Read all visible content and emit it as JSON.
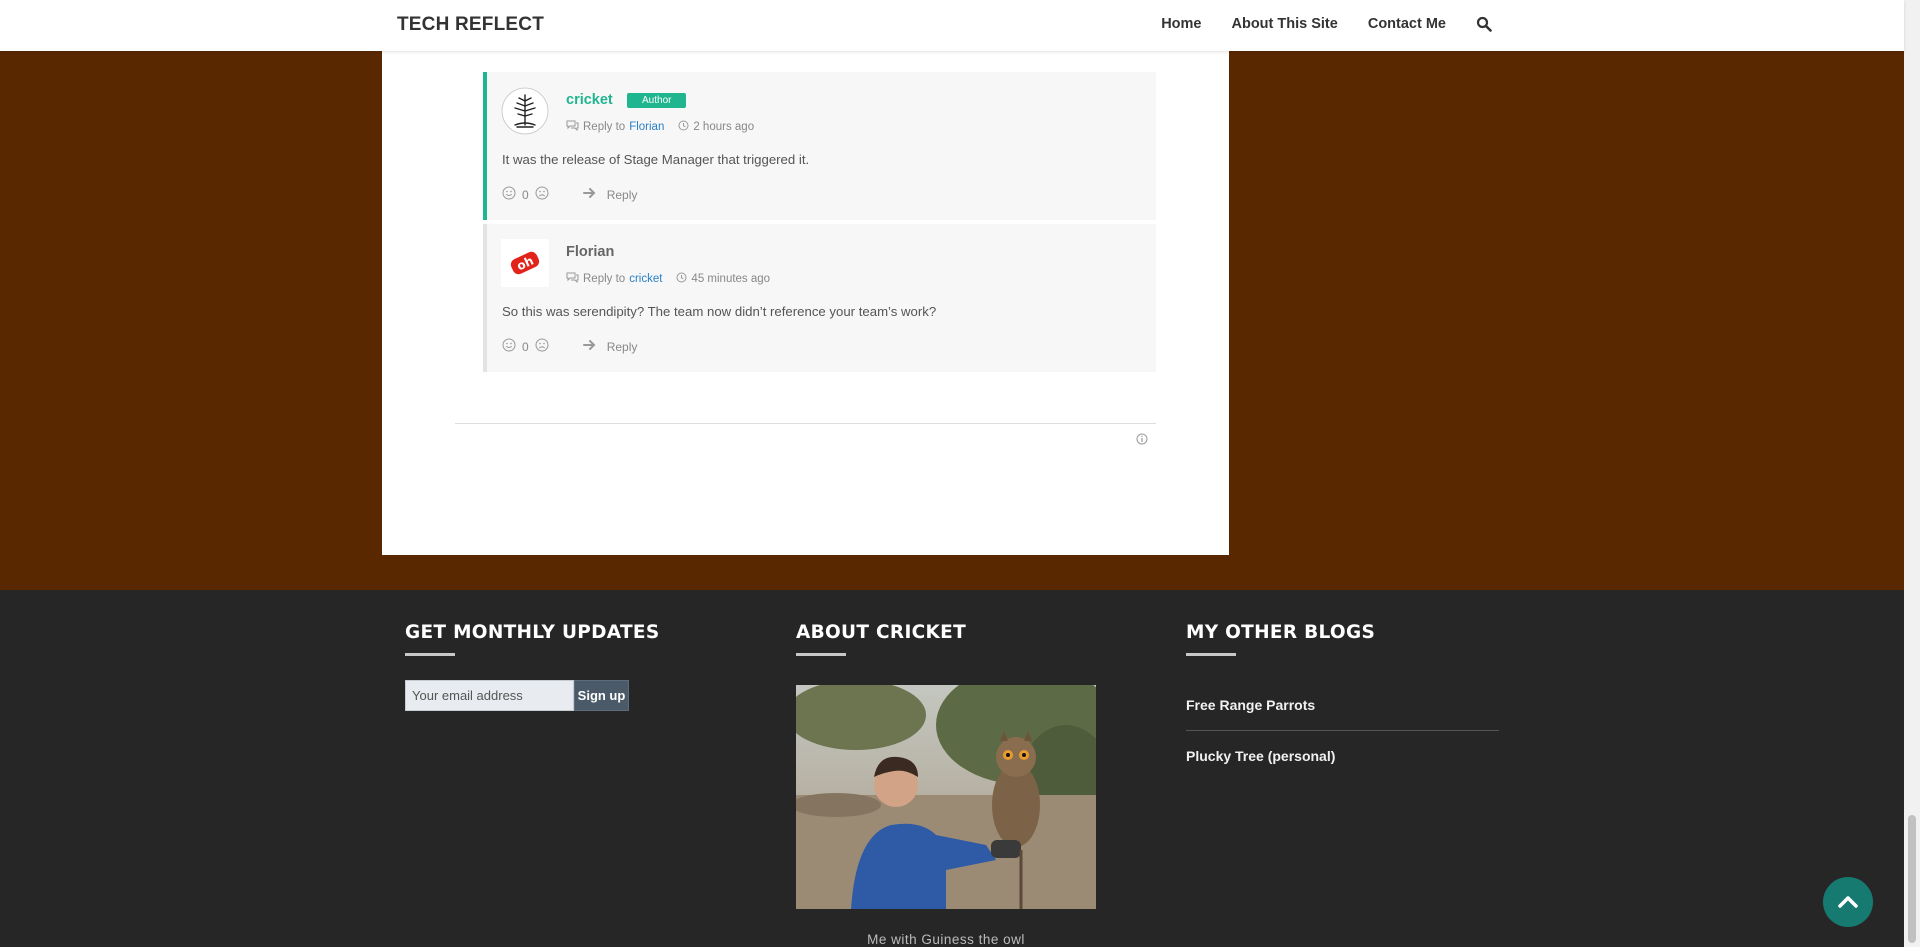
{
  "site": {
    "brand": "TECH REFLECT"
  },
  "nav": {
    "items": [
      "Home",
      "About This Site",
      "Contact Me"
    ]
  },
  "comments": [
    {
      "author": "cricket",
      "badge": "Author",
      "reply_prefix": "Reply to",
      "reply_to": "Florian",
      "time": "2 hours ago",
      "text": "It was the release of Stage Manager that triggered it.",
      "votes": "0",
      "reply_label": "Reply"
    },
    {
      "author": "Florian",
      "reply_prefix": "Reply to",
      "reply_to": "cricket",
      "time": "45 minutes ago",
      "text": "So this was serendipity? The team now didn’t reference your team’s work?",
      "votes": "0",
      "reply_label": "Reply"
    }
  ],
  "footer": {
    "updates": {
      "heading": "GET MONTHLY UPDATES",
      "email_placeholder": "Your email address",
      "signup_label": "Sign up"
    },
    "about": {
      "heading": "ABOUT CRICKET",
      "caption": "Me with Guiness the owl"
    },
    "blogs": {
      "heading": "MY OTHER BLOGS",
      "items": [
        "Free Range Parrots",
        "Plucky Tree (personal)"
      ]
    }
  },
  "colors": {
    "background": "#5a2800",
    "accent": "#1fb58f",
    "link": "#2b80c5",
    "footer": "#262626",
    "back_to_top": "#167a70"
  }
}
